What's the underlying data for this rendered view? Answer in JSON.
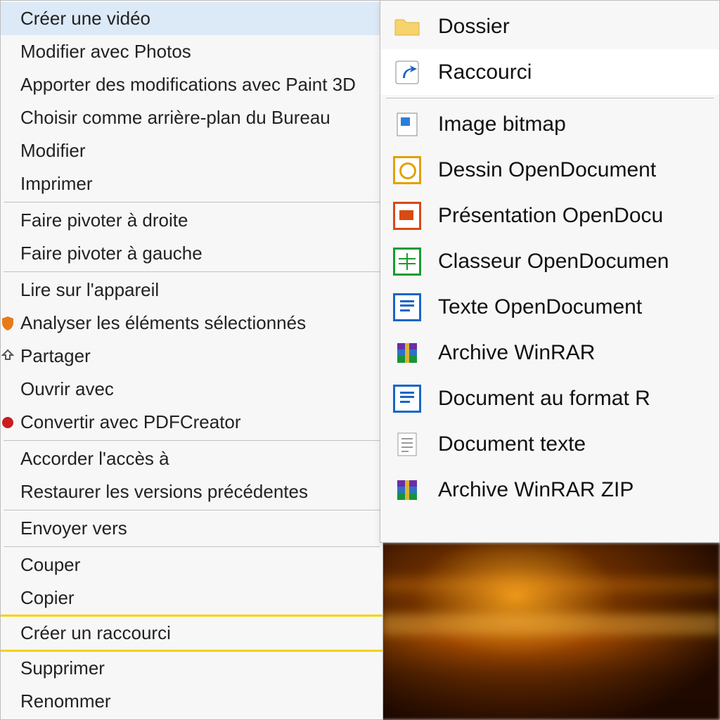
{
  "context_menu": {
    "groups": [
      [
        {
          "id": "create-video",
          "label": "Créer une vidéo",
          "hover": true
        },
        {
          "id": "edit-photos",
          "label": "Modifier avec Photos"
        },
        {
          "id": "paint3d",
          "label": "Apporter des modifications avec Paint 3D"
        },
        {
          "id": "set-wallpaper",
          "label": "Choisir comme arrière-plan du Bureau"
        },
        {
          "id": "edit",
          "label": "Modifier"
        },
        {
          "id": "print",
          "label": "Imprimer"
        }
      ],
      [
        {
          "id": "rotate-right",
          "label": "Faire pivoter à droite"
        },
        {
          "id": "rotate-left",
          "label": "Faire pivoter à gauche"
        }
      ],
      [
        {
          "id": "play-device",
          "label": "Lire sur l'appareil"
        },
        {
          "id": "av-scan",
          "label": "Analyser les éléments sélectionnés",
          "icon": "shield"
        },
        {
          "id": "share",
          "label": "Partager",
          "icon": "share"
        },
        {
          "id": "open-with",
          "label": "Ouvrir avec"
        },
        {
          "id": "pdfcreator",
          "label": "Convertir avec PDFCreator",
          "icon": "pdf"
        }
      ],
      [
        {
          "id": "give-access",
          "label": "Accorder l'accès à"
        },
        {
          "id": "restore-prev",
          "label": "Restaurer les versions précédentes"
        }
      ],
      [
        {
          "id": "send-to",
          "label": "Envoyer vers"
        }
      ],
      [
        {
          "id": "cut",
          "label": "Couper"
        },
        {
          "id": "copy",
          "label": "Copier"
        }
      ]
    ],
    "highlight_group": [
      {
        "id": "create-shortcut",
        "label": "Créer un raccourci"
      }
    ],
    "tail": [
      {
        "id": "delete",
        "label": "Supprimer"
      },
      {
        "id": "rename",
        "label": "Renommer"
      }
    ]
  },
  "submenu": {
    "top": [
      {
        "id": "new-folder",
        "label": "Dossier",
        "icon": "folder"
      },
      {
        "id": "new-shortcut",
        "label": "Raccourci",
        "icon": "shortcut",
        "hover": true
      }
    ],
    "bottom": [
      {
        "id": "new-bitmap",
        "label": "Image bitmap",
        "icon": "bitmap"
      },
      {
        "id": "new-odg",
        "label": "Dessin OpenDocument",
        "icon": "od-draw"
      },
      {
        "id": "new-odp",
        "label": "Présentation OpenDocu",
        "icon": "od-pres"
      },
      {
        "id": "new-ods",
        "label": "Classeur OpenDocumen",
        "icon": "od-calc"
      },
      {
        "id": "new-odt",
        "label": "Texte OpenDocument",
        "icon": "od-text"
      },
      {
        "id": "new-rar",
        "label": "Archive WinRAR",
        "icon": "winrar"
      },
      {
        "id": "new-rtf",
        "label": "Document au format R",
        "icon": "od-text"
      },
      {
        "id": "new-txt",
        "label": "Document texte",
        "icon": "txt"
      },
      {
        "id": "new-zip",
        "label": "Archive WinRAR ZIP",
        "icon": "winrar"
      }
    ]
  }
}
